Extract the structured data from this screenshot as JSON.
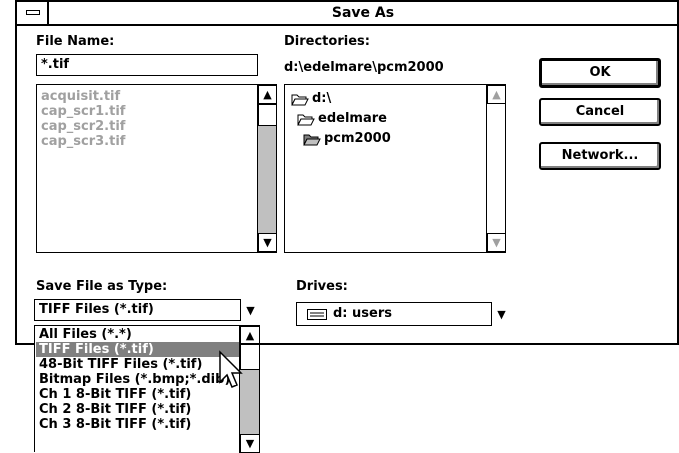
{
  "window": {
    "title": "Save As"
  },
  "filename": {
    "label": "File Name:",
    "value": "*.tif",
    "files": [
      "acquisit.tif",
      "cap_scr1.tif",
      "cap_scr2.tif",
      "cap_scr3.tif"
    ]
  },
  "directories": {
    "label": "Directories:",
    "current_path": "d:\\edelmare\\pcm2000",
    "tree": [
      "d:\\",
      "edelmare",
      "pcm2000"
    ]
  },
  "buttons": {
    "ok": "OK",
    "cancel": "Cancel",
    "network": "Network..."
  },
  "save_type": {
    "label": "Save File as Type:",
    "selected": "TIFF Files (*.tif)",
    "options": [
      "All Files (*.*)",
      "TIFF Files (*.tif)",
      "48-Bit TIFF Files (*.tif)",
      "Bitmap Files (*.bmp;*.dib)",
      "Ch 1 8-Bit TIFF (*.tif)",
      "Ch 2 8-Bit TIFF (*.tif)",
      "Ch 3 8-Bit TIFF (*.tif)"
    ]
  },
  "drives": {
    "label": "Drives:",
    "selected": "d: users"
  },
  "icons": {
    "scroll_up": "▲",
    "scroll_down": "▼",
    "dropdown": "▼"
  }
}
